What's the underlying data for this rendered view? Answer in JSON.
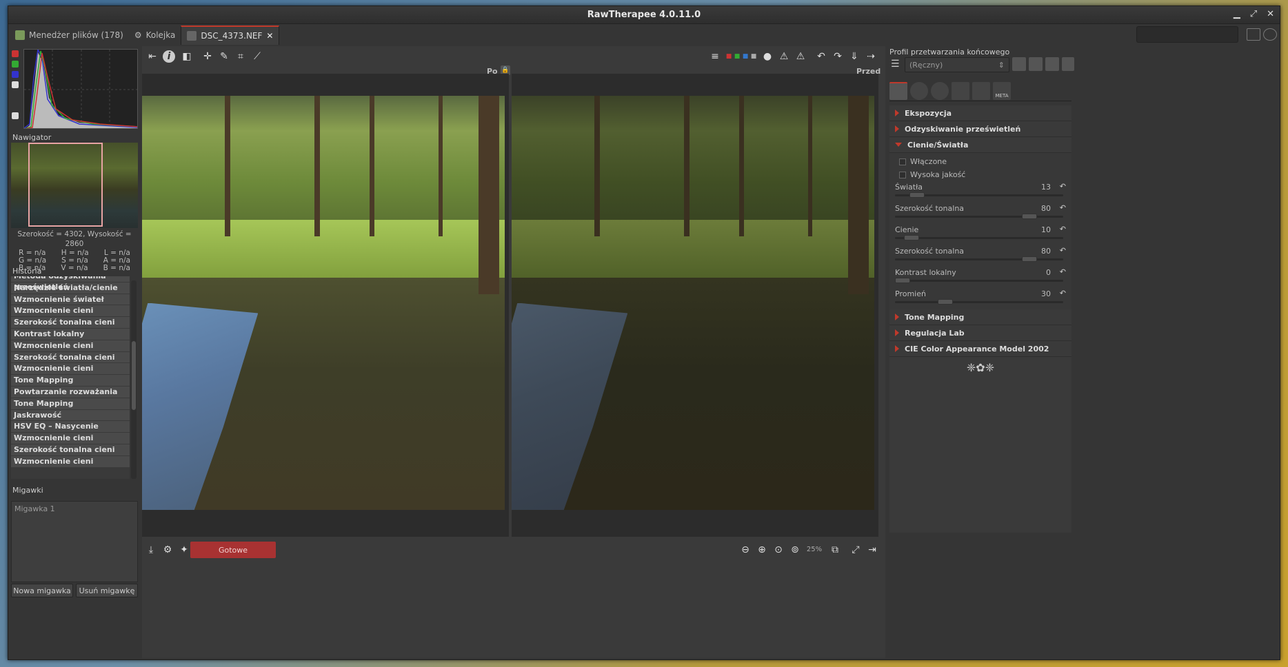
{
  "window": {
    "title": "RawTherapee 4.0.11.0"
  },
  "tabs": [
    {
      "label": "Menedżer plików (178)"
    },
    {
      "label": "Kolejka"
    },
    {
      "label": "DSC_4373.NEF"
    }
  ],
  "navigator": {
    "title": "Nawigator",
    "size": "Szerokość = 4302, Wysokość = 2860",
    "rows": [
      [
        "R = n/a",
        "H = n/a",
        "L = n/a"
      ],
      [
        "G = n/a",
        "S = n/a",
        "A = n/a"
      ],
      [
        "B = n/a",
        "V = n/a",
        "B = n/a"
      ]
    ]
  },
  "history": {
    "title": "Historia",
    "items": [
      "Metoda odzyskiwania prześwietleń",
      "Narzędzie światła/cienie",
      "Wzmocnienie świateł",
      "Wzmocnienie cieni",
      "Szerokość tonalna cieni",
      "Kontrast lokalny",
      "Wzmocnienie cieni",
      "Szerokość tonalna cieni",
      "Wzmocnienie cieni",
      "Tone Mapping",
      "Powtarzanie rozważania",
      "Tone Mapping",
      "Jaskrawość",
      "HSV EQ – Nasycenie",
      "Wzmocnienie cieni",
      "Szerokość tonalna cieni",
      "Wzmocnienie cieni"
    ]
  },
  "snapshots": {
    "title": "Migawki",
    "items": [
      "Migawka 1"
    ],
    "new_btn": "Nowa migawka",
    "del_btn": "Usuń migawkę"
  },
  "viewer": {
    "left_label": "Po",
    "right_label": "Przed",
    "status": "Gotowe",
    "zoom": "25%"
  },
  "right": {
    "profile_title": "Profil przetwarzania końcowego",
    "profile_value": "(Ręczny)",
    "meta_tab": "META",
    "sections": [
      "Ekspozycja",
      "Odzyskiwanie prześwietleń",
      "Cienie/Światła"
    ],
    "checks": [
      "Włączone",
      "Wysoka jakość"
    ],
    "sliders": [
      {
        "name": "Światła",
        "value": "13",
        "pos": 0.13
      },
      {
        "name": "Szerokość tonalna",
        "value": "80",
        "pos": 0.8
      },
      {
        "name": "Cienie",
        "value": "10",
        "pos": 0.1
      },
      {
        "name": "Szerokość tonalna",
        "value": "80",
        "pos": 0.8
      },
      {
        "name": "Kontrast lokalny",
        "value": "0",
        "pos": 0.0
      },
      {
        "name": "Promień",
        "value": "30",
        "pos": 0.3
      }
    ],
    "sections2": [
      "Tone Mapping",
      "Regulacja Lab",
      "CIE Color Appearance Model 2002"
    ]
  },
  "colors": {
    "accent": "#c0392b",
    "status": "#a83232"
  }
}
